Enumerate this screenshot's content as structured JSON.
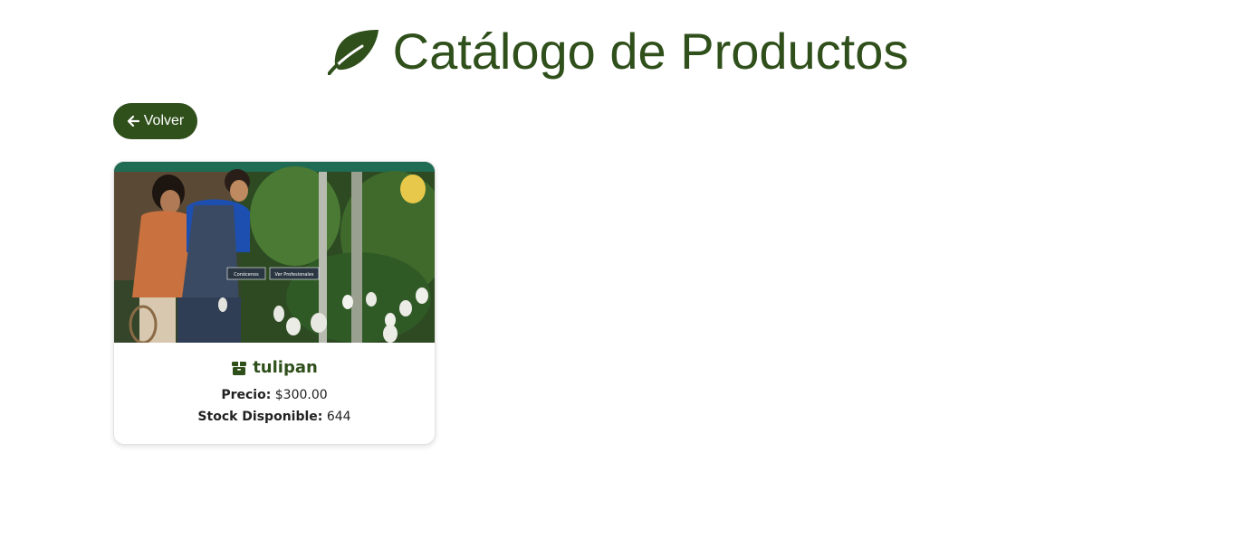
{
  "header": {
    "title": "Catálogo de Productos",
    "icon": "leaf-icon"
  },
  "nav": {
    "back_label": "Volver",
    "back_icon": "arrow-left-icon"
  },
  "products": [
    {
      "name": "tulipan",
      "icon": "box-icon",
      "price_label": "Precio:",
      "price": "$300.00",
      "stock_label": "Stock Disponible:",
      "stock": "644",
      "image": {
        "description_buttons": [
          "Conócenos",
          "Ver Profesionales"
        ]
      }
    }
  ],
  "colors": {
    "primary": "#2f4f1b",
    "text": "#222222",
    "background": "#ffffff"
  }
}
